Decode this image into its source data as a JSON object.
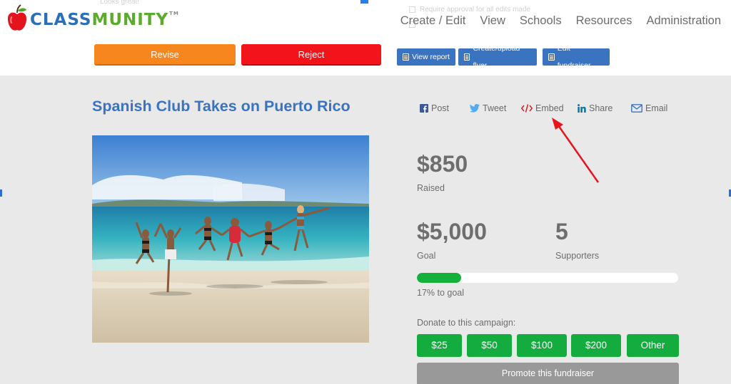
{
  "header": {
    "logo_text_a": "CLASS",
    "logo_text_b": "MUNITY",
    "logo_tm": "TM",
    "nav": [
      "Create / Edit",
      "View",
      "Schools",
      "Resources",
      "Administration"
    ],
    "ghost_text_1": "Looks great!",
    "ghost_text_2": "Require approval for all edits made"
  },
  "actions": {
    "revise": "Revise",
    "reject": "Reject",
    "view_report": "View report",
    "create_flyer": "Create/upload flyer",
    "edit_fundraiser": "Edit fundraiser"
  },
  "campaign": {
    "title": "Spanish Club Takes on Puerto Rico"
  },
  "share": {
    "post": "Post",
    "tweet": "Tweet",
    "embed": "Embed",
    "share": "Share",
    "email": "Email"
  },
  "stats": {
    "raised_value": "$850",
    "raised_label": "Raised",
    "goal_value": "$5,000",
    "goal_label": "Goal",
    "supporters_value": "5",
    "supporters_label": "Supporters",
    "progress_percent": 17,
    "progress_label": "17% to goal"
  },
  "donate": {
    "label": "Donate to this campaign:",
    "amounts": [
      "$25",
      "$50",
      "$100",
      "$200",
      "Other"
    ],
    "promote": "Promote this fundraiser"
  },
  "colors": {
    "accent_blue": "#3a73bf",
    "revise_orange": "#f7861f",
    "reject_red": "#f3131a",
    "donate_green": "#14ab3f",
    "annotation_red": "#e8141c"
  }
}
